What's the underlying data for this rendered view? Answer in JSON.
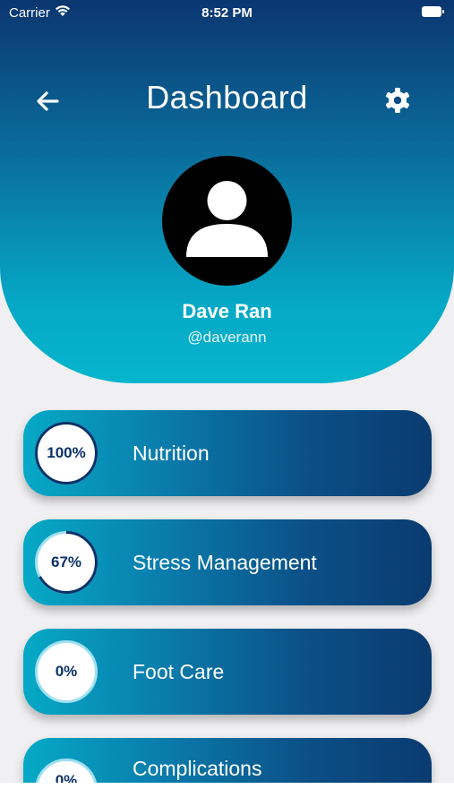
{
  "status_bar": {
    "carrier": "Carrier",
    "time": "8:52 PM"
  },
  "header": {
    "title": "Dashboard",
    "back_icon": "back-arrow-icon",
    "settings_icon": "gear-icon"
  },
  "profile": {
    "name": "Dave Ran",
    "handle": "@daverann",
    "avatar_icon": "user-silhouette-icon"
  },
  "colors": {
    "header_top": "#0b3670",
    "header_bottom": "#06b5cd",
    "card_left": "#06a9c6",
    "card_right": "#0a3b70",
    "ring_progress": "#0b3268",
    "ring_track": "#9fe0ef"
  },
  "modules": [
    {
      "label": "Nutrition",
      "percent_text": "100%",
      "progress": 100
    },
    {
      "label": "Stress Management",
      "percent_text": "67%",
      "progress": 67
    },
    {
      "label": "Foot Care",
      "percent_text": "0%",
      "progress": 0
    },
    {
      "label": "Complications",
      "percent_text": "0%",
      "progress": 0
    }
  ]
}
